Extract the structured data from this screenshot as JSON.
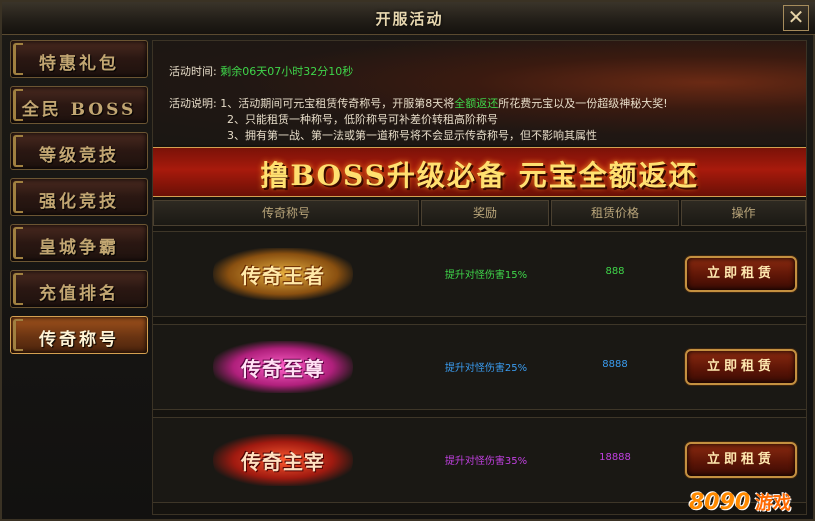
{
  "window": {
    "title": "开服活动",
    "close_symbol": "✕"
  },
  "sidebar": {
    "items": [
      {
        "label": "特惠礼包",
        "active": false
      },
      {
        "label": "全民 BOSS",
        "active": false
      },
      {
        "label": "等级竞技",
        "active": false
      },
      {
        "label": "强化竞技",
        "active": false
      },
      {
        "label": "皇城争霸",
        "active": false
      },
      {
        "label": "充值排名",
        "active": false
      },
      {
        "label": "传奇称号",
        "active": true
      }
    ]
  },
  "info": {
    "time_label": "活动时间:",
    "countdown": "剩余06天07小时32分10秒",
    "desc_label": "活动说明:",
    "desc_1a": "1、活动期间可元宝租赁传奇称号，开服第8天将",
    "desc_1b": "全额返还",
    "desc_1c": "所花费元宝以及一份超级神秘大奖!",
    "desc_2": "2、只能租赁一种称号，低阶称号可补差价转租高阶称号",
    "desc_3": "3、拥有第一战、第一法或第一道称号将不会显示传奇称号，但不影响其属性"
  },
  "banner": {
    "text": "撸BOSS升级必备   元宝全额返还"
  },
  "table": {
    "headers": [
      "传奇称号",
      "奖励",
      "租赁价格",
      "操作"
    ],
    "rows": [
      {
        "title": "传奇王者",
        "reward": "提升对怪伤害15%",
        "price": "888",
        "button": "立即租赁",
        "reward_color": "#3fd64a",
        "price_color": "#3fd64a"
      },
      {
        "title": "传奇至尊",
        "reward": "提升对怪伤害25%",
        "price": "8888",
        "button": "立即租赁",
        "reward_color": "#3a9cf0",
        "price_color": "#3a9cf0"
      },
      {
        "title": "传奇主宰",
        "reward": "提升对怪伤害35%",
        "price": "18888",
        "button": "立即租赁",
        "reward_color": "#c040e0",
        "price_color": "#c040e0"
      }
    ]
  },
  "watermark": {
    "num": "8090",
    "cn": "游戏"
  },
  "colors": {
    "accent_gold": "#d4a050",
    "banner_red": "#a81a0c",
    "countdown_green": "#3fd64a"
  }
}
